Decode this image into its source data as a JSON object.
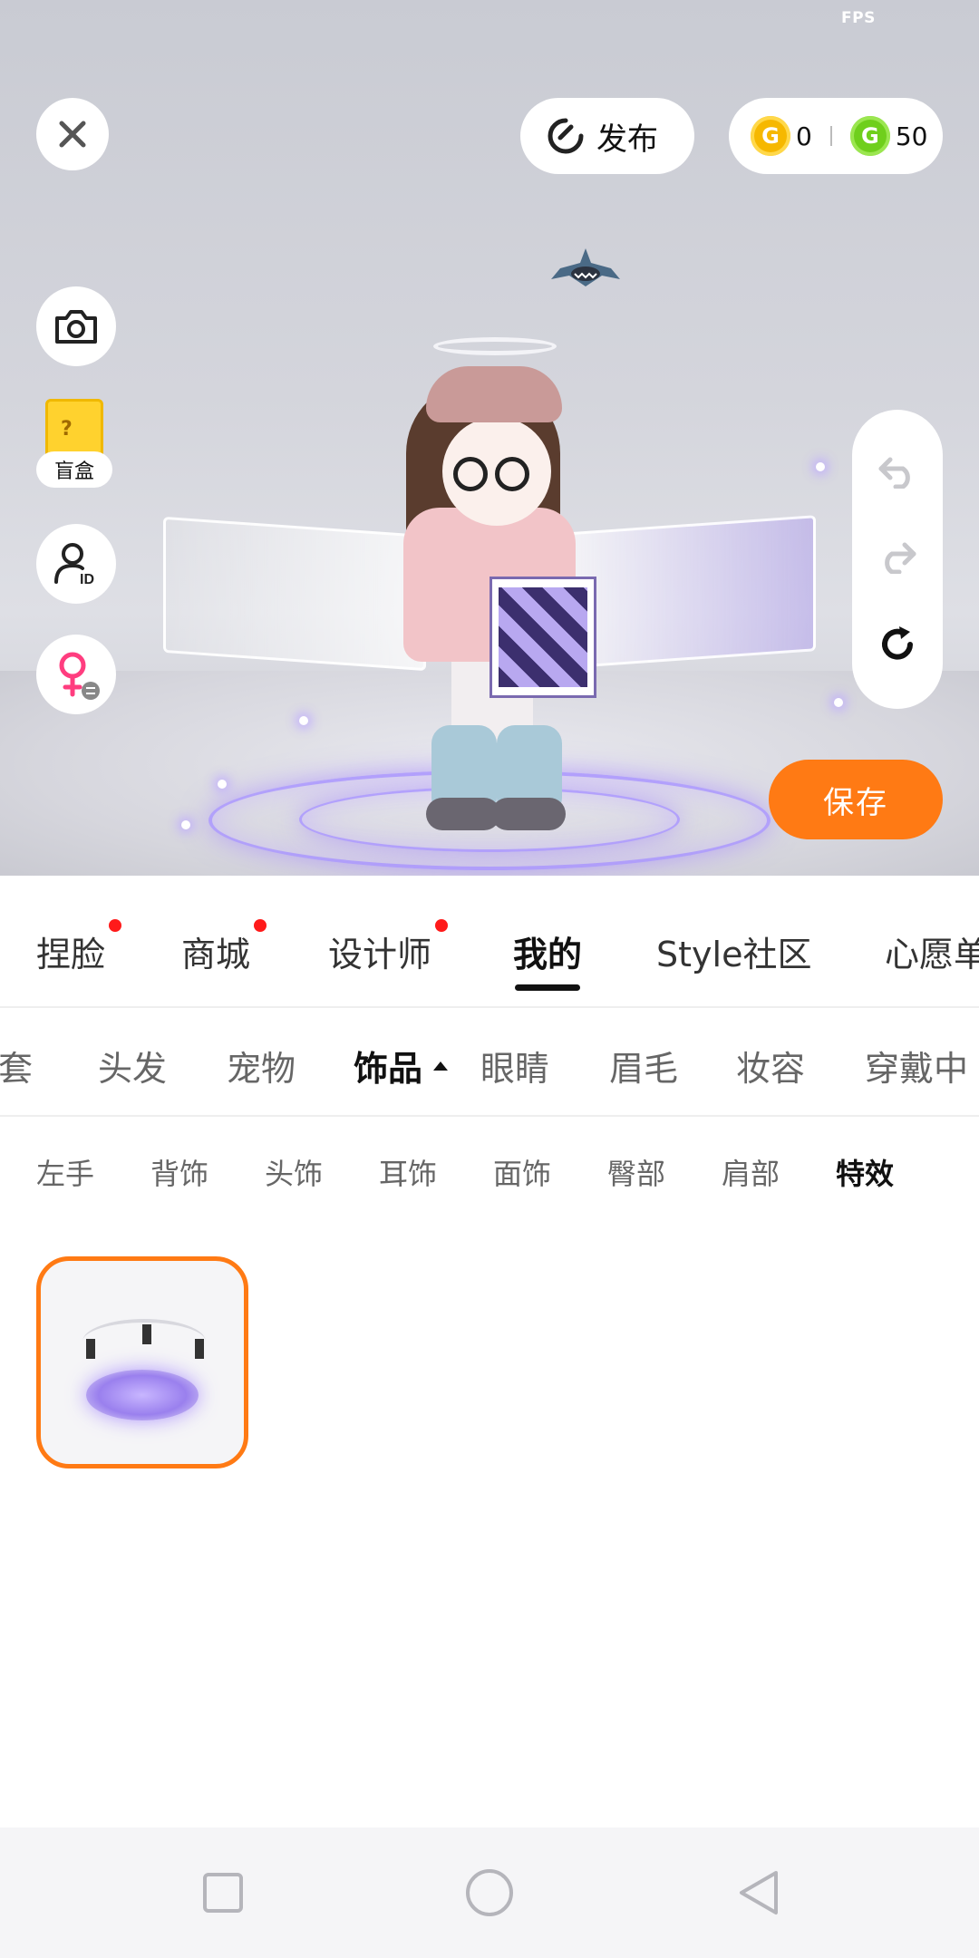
{
  "status": {
    "fps_label": "FPS",
    "fps_value": ""
  },
  "header": {
    "close_icon": "close-icon",
    "publish_label": "发布",
    "currency": [
      {
        "icon": "gold-coin-icon",
        "value": "0",
        "color": "#f6b800"
      },
      {
        "icon": "green-coin-icon",
        "value": "50",
        "color": "#6fcf1c"
      }
    ]
  },
  "left_tools": {
    "camera_icon": "camera-icon",
    "blindbox_label": "盲盒",
    "profile_id_icon": "user-id-icon",
    "gender_icon": "gender-switch-icon"
  },
  "history_controls": [
    "undo-icon",
    "redo-icon",
    "reset-icon"
  ],
  "save_label": "保存",
  "main_tabs": [
    {
      "label": "捏脸",
      "badge": true
    },
    {
      "label": "商城",
      "badge": true
    },
    {
      "label": "设计师",
      "badge": true
    },
    {
      "label": "我的",
      "badge": false,
      "active": true
    },
    {
      "label": "Style社区",
      "badge": false
    },
    {
      "label": "心愿单",
      "badge": false
    }
  ],
  "categories": [
    {
      "label": "手套"
    },
    {
      "label": "头发"
    },
    {
      "label": "宠物"
    },
    {
      "label": "饰品",
      "active": true
    },
    {
      "label": "眼睛"
    },
    {
      "label": "眉毛"
    },
    {
      "label": "妆容"
    },
    {
      "label": "穿戴中"
    }
  ],
  "subcategories": [
    {
      "label": "左手"
    },
    {
      "label": "背饰"
    },
    {
      "label": "头饰"
    },
    {
      "label": "耳饰"
    },
    {
      "label": "面饰"
    },
    {
      "label": "臀部"
    },
    {
      "label": "肩部"
    },
    {
      "label": "特效",
      "active": true
    }
  ],
  "items": [
    {
      "name": "magic-circle-effect",
      "selected": true
    }
  ],
  "colors": {
    "accent": "#ff7a14",
    "badge": "#ff1a1a"
  },
  "system_nav": [
    "recent-apps-icon",
    "home-icon",
    "back-icon"
  ]
}
